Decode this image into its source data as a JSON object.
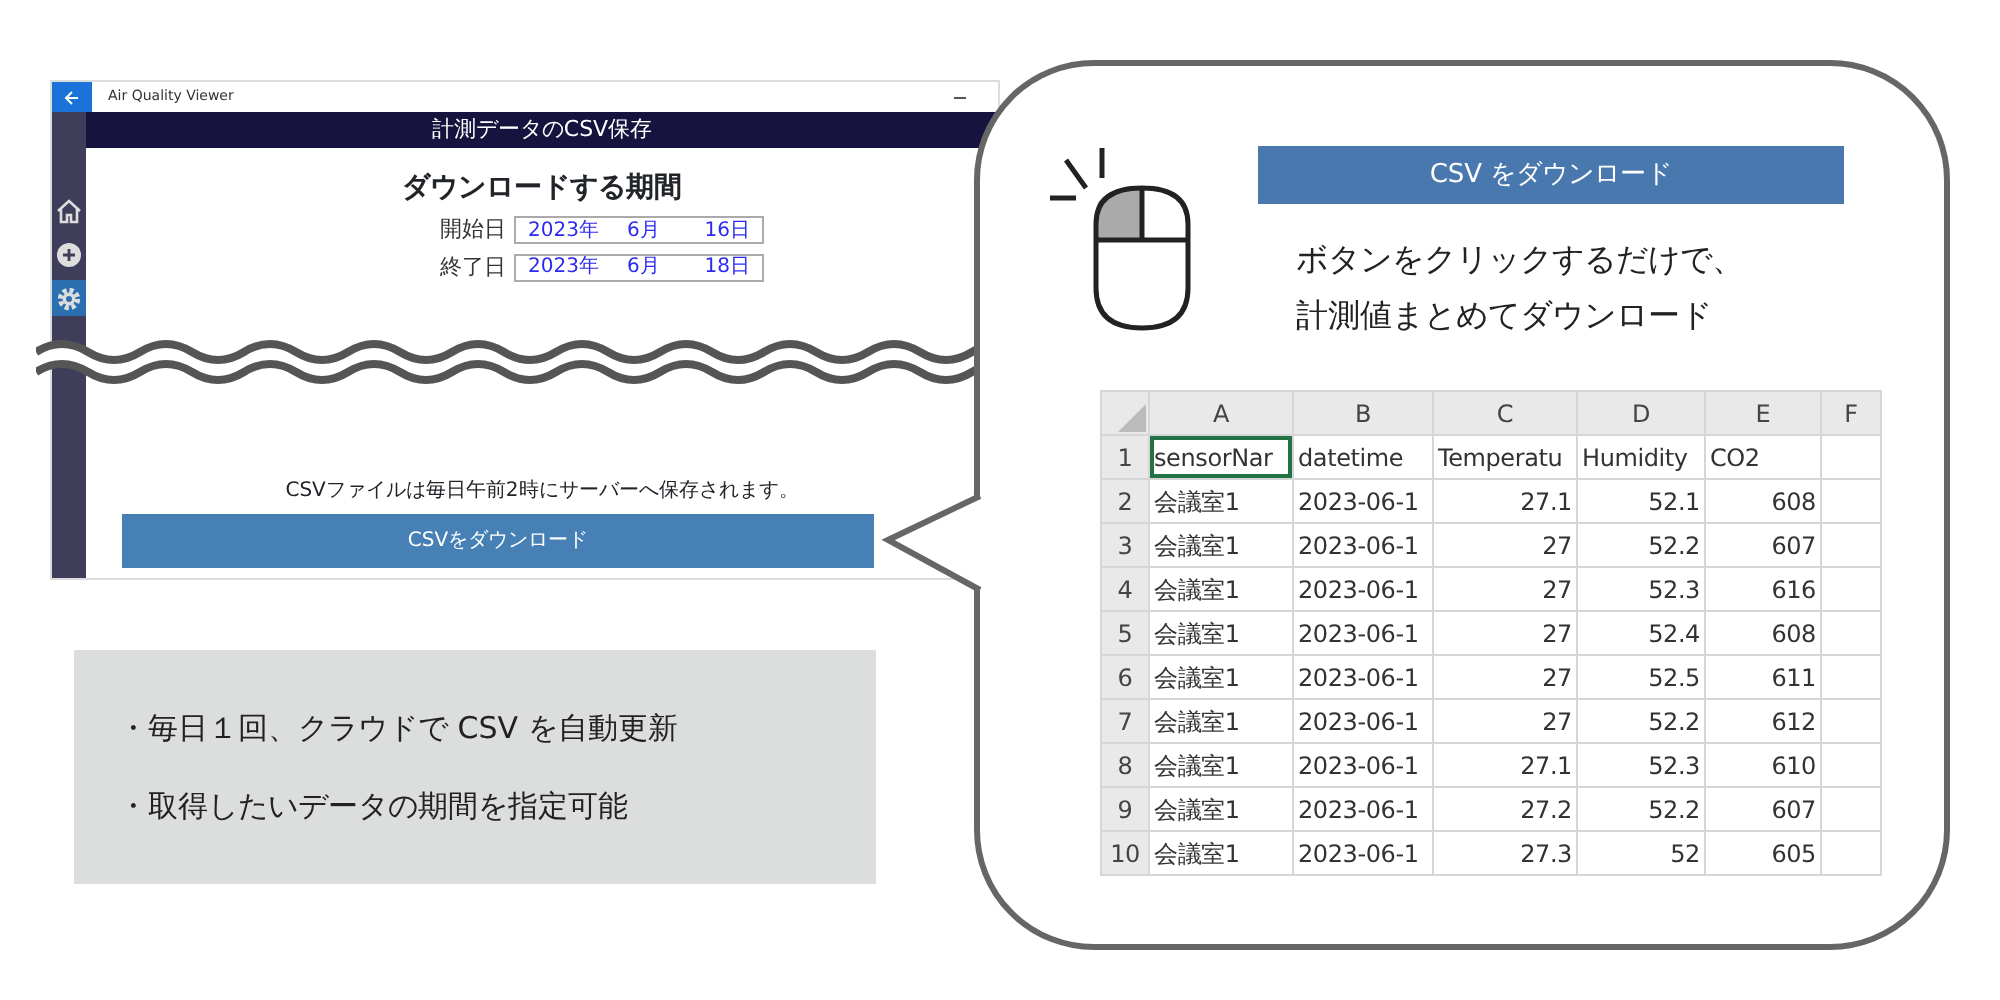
{
  "app": {
    "title": "Air Quality Viewer",
    "header": "計測データのCSV保存",
    "nav": [
      {
        "selected": false
      },
      {
        "selected": false
      },
      {
        "selected": true
      }
    ],
    "period_title": "ダウンロードする期間",
    "dates": [
      {
        "label": "開始日",
        "year": "2023年",
        "month": "6月",
        "day": "16日"
      },
      {
        "label": "終了日",
        "year": "2023年",
        "month": "6月",
        "day": "18日"
      }
    ],
    "note": "CSVファイルは毎日午前2時にサーバーへ保存されます。",
    "download_button": "CSVをダウンロード"
  },
  "features": [
    "・毎日１回、クラウドで CSV を自動更新",
    "・取得したいデータの期間を指定可能"
  ],
  "callout": {
    "label": "CSV をダウンロード",
    "description": [
      "ボタンをクリックするだけで、",
      "計測値まとめてダウンロード"
    ],
    "sheet": {
      "columns": [
        "A",
        "B",
        "C",
        "D",
        "E",
        "F"
      ],
      "rows": [
        {
          "number": "1",
          "cells": [
            {
              "text": "sensorNar",
              "selected": true
            },
            {
              "text": "datetime",
              "selected": false
            },
            {
              "text": "Temperatu",
              "selected": false
            },
            {
              "text": "Humidity",
              "selected": false
            },
            {
              "text": "CO2",
              "selected": false
            }
          ]
        },
        {
          "number": "2",
          "cells": [
            {
              "text": "会議室1",
              "selected": false
            },
            {
              "text": "2023-06-1",
              "selected": false
            },
            {
              "text": "27.1",
              "selected": false
            },
            {
              "text": "52.1",
              "selected": false
            },
            {
              "text": "608",
              "selected": false
            }
          ]
        },
        {
          "number": "3",
          "cells": [
            {
              "text": "会議室1",
              "selected": false
            },
            {
              "text": "2023-06-1",
              "selected": false
            },
            {
              "text": "27",
              "selected": false
            },
            {
              "text": "52.2",
              "selected": false
            },
            {
              "text": "607",
              "selected": false
            }
          ]
        },
        {
          "number": "4",
          "cells": [
            {
              "text": "会議室1",
              "selected": false
            },
            {
              "text": "2023-06-1",
              "selected": false
            },
            {
              "text": "27",
              "selected": false
            },
            {
              "text": "52.3",
              "selected": false
            },
            {
              "text": "616",
              "selected": false
            }
          ]
        },
        {
          "number": "5",
          "cells": [
            {
              "text": "会議室1",
              "selected": false
            },
            {
              "text": "2023-06-1",
              "selected": false
            },
            {
              "text": "27",
              "selected": false
            },
            {
              "text": "52.4",
              "selected": false
            },
            {
              "text": "608",
              "selected": false
            }
          ]
        },
        {
          "number": "6",
          "cells": [
            {
              "text": "会議室1",
              "selected": false
            },
            {
              "text": "2023-06-1",
              "selected": false
            },
            {
              "text": "27",
              "selected": false
            },
            {
              "text": "52.5",
              "selected": false
            },
            {
              "text": "611",
              "selected": false
            }
          ]
        },
        {
          "number": "7",
          "cells": [
            {
              "text": "会議室1",
              "selected": false
            },
            {
              "text": "2023-06-1",
              "selected": false
            },
            {
              "text": "27",
              "selected": false
            },
            {
              "text": "52.2",
              "selected": false
            },
            {
              "text": "612",
              "selected": false
            }
          ]
        },
        {
          "number": "8",
          "cells": [
            {
              "text": "会議室1",
              "selected": false
            },
            {
              "text": "2023-06-1",
              "selected": false
            },
            {
              "text": "27.1",
              "selected": false
            },
            {
              "text": "52.3",
              "selected": false
            },
            {
              "text": "610",
              "selected": false
            }
          ]
        },
        {
          "number": "9",
          "cells": [
            {
              "text": "会議室1",
              "selected": false
            },
            {
              "text": "2023-06-1",
              "selected": false
            },
            {
              "text": "27.2",
              "selected": false
            },
            {
              "text": "52.2",
              "selected": false
            },
            {
              "text": "607",
              "selected": false
            }
          ]
        },
        {
          "number": "10",
          "cells": [
            {
              "text": "会議室1",
              "selected": false
            },
            {
              "text": "2023-06-1",
              "selected": false
            },
            {
              "text": "27.3",
              "selected": false
            },
            {
              "text": "52",
              "selected": false
            },
            {
              "text": "605",
              "selected": false
            }
          ]
        }
      ]
    }
  }
}
